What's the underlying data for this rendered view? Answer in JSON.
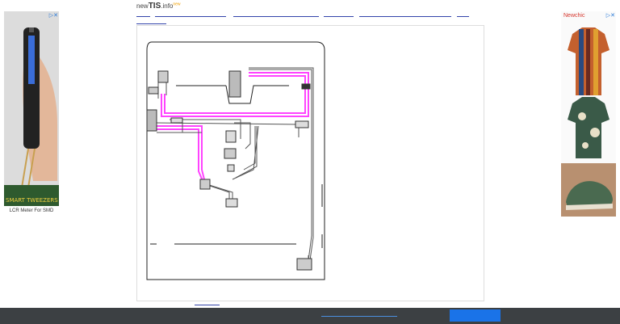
{
  "site": {
    "brand_prefix": "new",
    "brand_main": "TIS",
    "brand_suffix": ".info",
    "brand_badge": "new"
  },
  "ads": {
    "left": {
      "caption": "LCR Meter For SMD",
      "choices_icon": "adchoices-icon"
    },
    "right": {
      "brand": "Newchic",
      "choices_icon": "adchoices-icon"
    }
  },
  "breadcrumb": {
    "items": [
      "",
      "",
      "",
      "",
      "",
      "",
      ""
    ]
  },
  "diagram": {
    "type": "wiring-diagram",
    "highlight_color": "#ff33ff",
    "wire_color": "#555555"
  },
  "footer": {
    "link": "",
    "button": ""
  },
  "colors": {
    "footer_bg": "#3c4043",
    "button": "#1a73e8",
    "link": "#3344aa"
  }
}
